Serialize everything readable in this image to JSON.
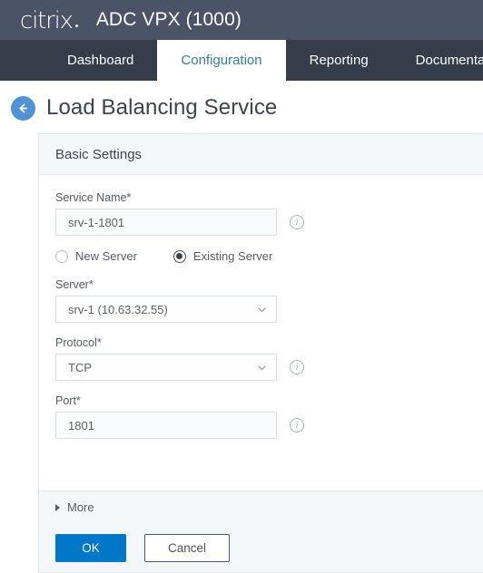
{
  "brand": {
    "logo_text": "citrix",
    "logo_icon": "citrix-logo",
    "app_title": "ADC VPX (1000)"
  },
  "tabs": [
    {
      "label": "Dashboard",
      "active": false
    },
    {
      "label": "Configuration",
      "active": true
    },
    {
      "label": "Reporting",
      "active": false
    },
    {
      "label": "Documentati",
      "active": false
    }
  ],
  "page": {
    "back_icon": "back-arrow-icon",
    "title": "Load Balancing Service"
  },
  "section": {
    "title": "Basic Settings"
  },
  "fields": {
    "service_name": {
      "label": "Service Name*",
      "value": "srv-1-1801",
      "placeholder": "",
      "info_icon": "info-icon"
    },
    "server_type": {
      "options": [
        {
          "label": "New Server",
          "selected": false
        },
        {
          "label": "Existing Server",
          "selected": true
        }
      ]
    },
    "server": {
      "label": "Server*",
      "value": "srv-1 (10.63.32.55)",
      "chevron_icon": "chevron-down-icon"
    },
    "protocol": {
      "label": "Protocol*",
      "value": "TCP",
      "chevron_icon": "chevron-down-icon",
      "info_icon": "info-icon"
    },
    "port": {
      "label": "Port*",
      "value": "1801",
      "placeholder": "",
      "info_icon": "info-icon"
    }
  },
  "more": {
    "label": "More",
    "expander_icon": "triangle-right-icon",
    "expanded": false
  },
  "footer": {
    "ok_label": "OK",
    "cancel_label": "Cancel"
  },
  "colors": {
    "brandbar_bg": "#4b5466",
    "tabbar_bg": "#353c4a",
    "active_tab_text": "#3a7ca8",
    "primary_button": "#0077c8",
    "back_button": "#5192d4",
    "section_bg": "#f4f7fa",
    "border": "#e3e7eb"
  },
  "info_glyph": "i"
}
